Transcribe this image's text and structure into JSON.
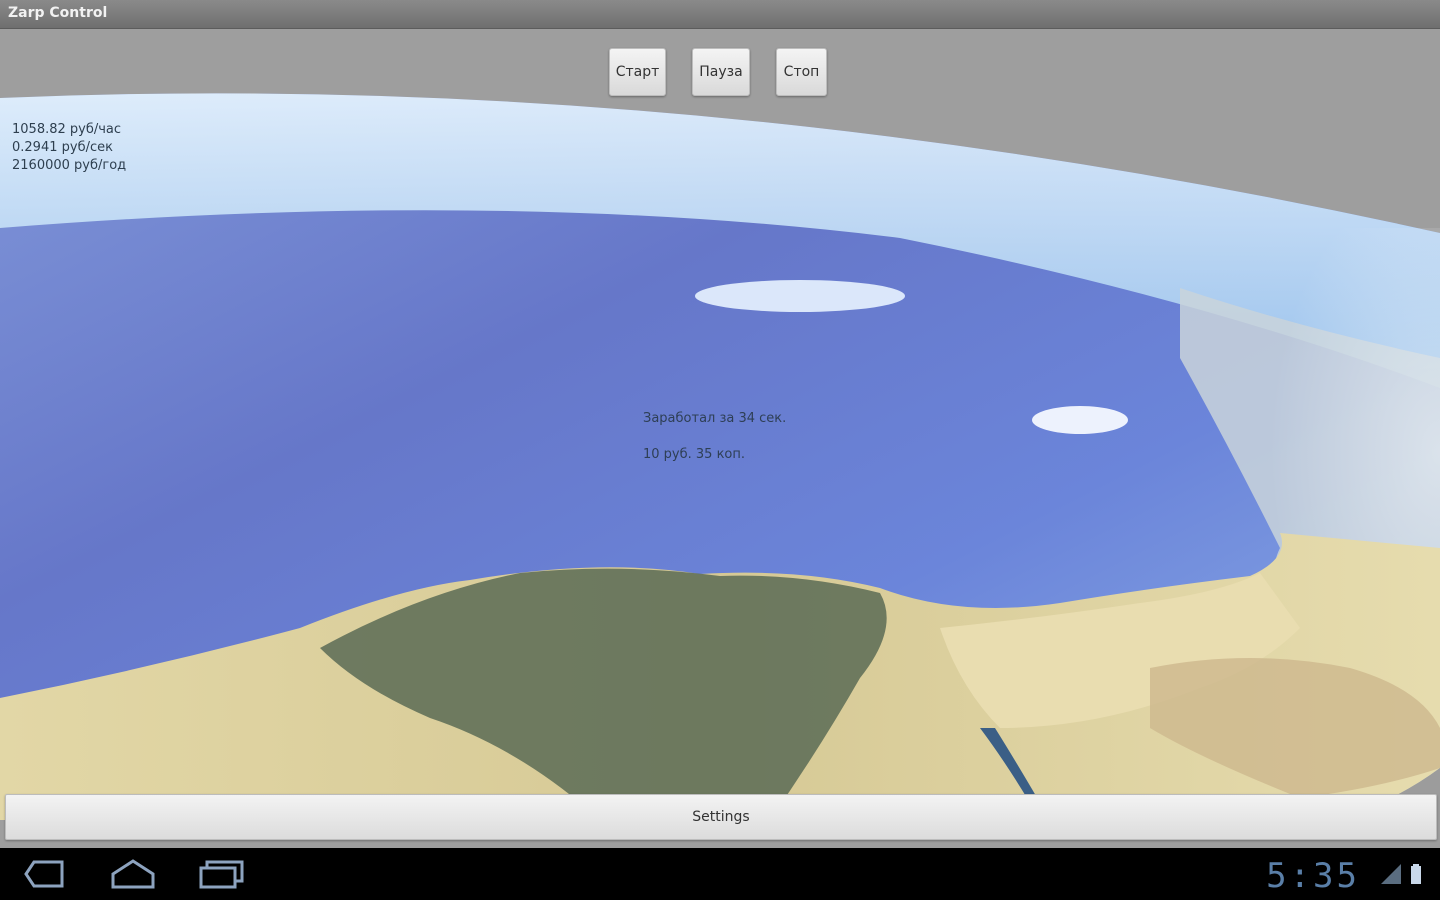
{
  "window": {
    "title": "Zarp Control"
  },
  "controls": {
    "start_label": "Старт",
    "pause_label": "Пауза",
    "stop_label": "Стоп"
  },
  "rates": {
    "per_hour": "1058.82 руб/час",
    "per_second": "0.2941 руб/сек",
    "per_year": "2160000 руб/год"
  },
  "earned": {
    "line1": "Заработал за 34 сек.",
    "line2": "10 руб. 35 коп."
  },
  "settings_label": "Settings",
  "system_bar": {
    "clock": "5:35",
    "icons": [
      "back-icon",
      "home-icon",
      "recent-apps-icon",
      "signal-icon",
      "battery-icon"
    ]
  },
  "colors": {
    "sea": "#5a7fd6",
    "land": "#b9a574",
    "clock": "#5a7fa8"
  }
}
